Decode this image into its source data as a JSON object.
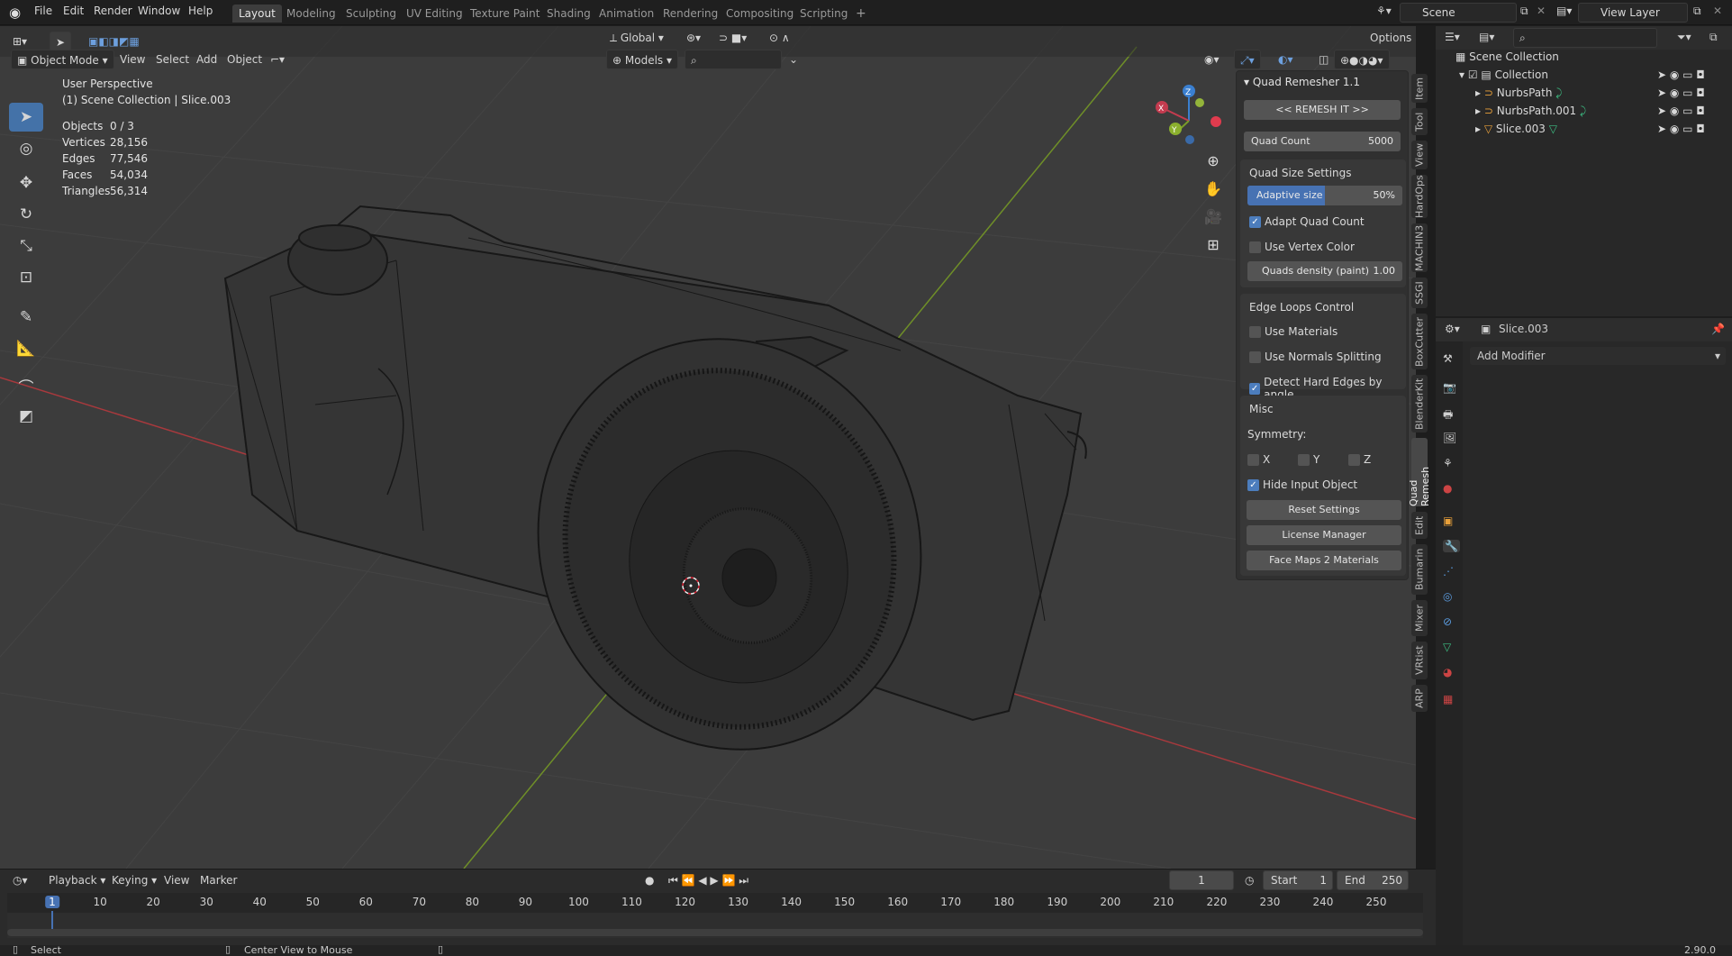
{
  "topbar": {
    "menus": [
      "File",
      "Edit",
      "Render",
      "Window",
      "Help"
    ],
    "workspaces": [
      "Layout",
      "Modeling",
      "Sculpting",
      "UV Editing",
      "Texture Paint",
      "Shading",
      "Animation",
      "Rendering",
      "Compositing",
      "Scripting"
    ],
    "active_workspace": "Layout",
    "add_tab": "+",
    "scene": "Scene",
    "view_layer": "View Layer"
  },
  "viewport_header": {
    "mode": "Object Mode",
    "menus": [
      "View",
      "Select",
      "Add",
      "Object"
    ],
    "orientation": "Global",
    "collection": "Models",
    "options": "Options"
  },
  "overlay": {
    "perspective": "User Perspective",
    "context": "(1) Scene Collection | Slice.003",
    "stats": [
      {
        "label": "Objects",
        "value": "0 / 3"
      },
      {
        "label": "Vertices",
        "value": "28,156"
      },
      {
        "label": "Edges",
        "value": "77,546"
      },
      {
        "label": "Faces",
        "value": "54,034"
      },
      {
        "label": "Triangles",
        "value": "56,314"
      }
    ]
  },
  "quad_remesher": {
    "title": "Quad Remesher 1.1",
    "remesh_button": "<< REMESH IT >>",
    "quad_count_label": "Quad Count",
    "quad_count_value": "5000",
    "quad_size_title": "Quad Size Settings",
    "adaptive_label": "Adaptive size",
    "adaptive_value": "50%",
    "adaptive_fraction": 0.5,
    "adapt_quad_count": "Adapt Quad Count",
    "use_vertex_color": "Use Vertex Color",
    "quads_density_label": "Quads density (paint)",
    "quads_density_value": "1.00",
    "edge_loops_title": "Edge Loops Control",
    "use_materials": "Use Materials",
    "use_normals": "Use Normals Splitting",
    "detect_hard": "Detect Hard Edges by angle",
    "misc_title": "Misc",
    "symmetry_label": "Symmetry:",
    "sym_x": "X",
    "sym_y": "Y",
    "sym_z": "Z",
    "hide_input": "Hide Input Object",
    "reset_settings": "Reset Settings",
    "license_manager": "License Manager",
    "face_maps": "Face Maps 2 Materials"
  },
  "side_tabs": [
    "Item",
    "Tool",
    "View",
    "HardOps",
    "MACHIN3",
    "SSGI",
    "BoxCutter",
    "BlenderKit",
    "Quad Remesh",
    "Edit",
    "Bumarin",
    "Mixer",
    "VRtist",
    "ARP"
  ],
  "active_side_tab": "Quad Remesh",
  "outliner": {
    "root": "Scene Collection",
    "collection": "Collection",
    "items": [
      "NurbsPath",
      "NurbsPath.001",
      "Slice.003"
    ]
  },
  "properties": {
    "object_name": "Slice.003",
    "add_modifier": "Add Modifier"
  },
  "timeline": {
    "menus": [
      "Playback",
      "Keying",
      "View",
      "Marker"
    ],
    "current_frame": "1",
    "start_label": "Start",
    "start_value": "1",
    "end_label": "End",
    "end_value": "250",
    "ticks": [
      "1",
      "10",
      "20",
      "30",
      "40",
      "50",
      "60",
      "70",
      "80",
      "90",
      "100",
      "110",
      "120",
      "130",
      "140",
      "150",
      "160",
      "170",
      "180",
      "190",
      "200",
      "210",
      "220",
      "230",
      "240",
      "250"
    ]
  },
  "statusbar": {
    "select": "Select",
    "center": "Center View to Mouse",
    "version": "2.90.0"
  },
  "gizmo": {
    "x": "X",
    "y": "Y",
    "z": "Z"
  },
  "colors": {
    "accent": "#4772b3",
    "x_axis": "#c43b4f",
    "y_axis": "#7a9c2a",
    "z_axis": "#3a7fd0",
    "wire": "#141414"
  }
}
